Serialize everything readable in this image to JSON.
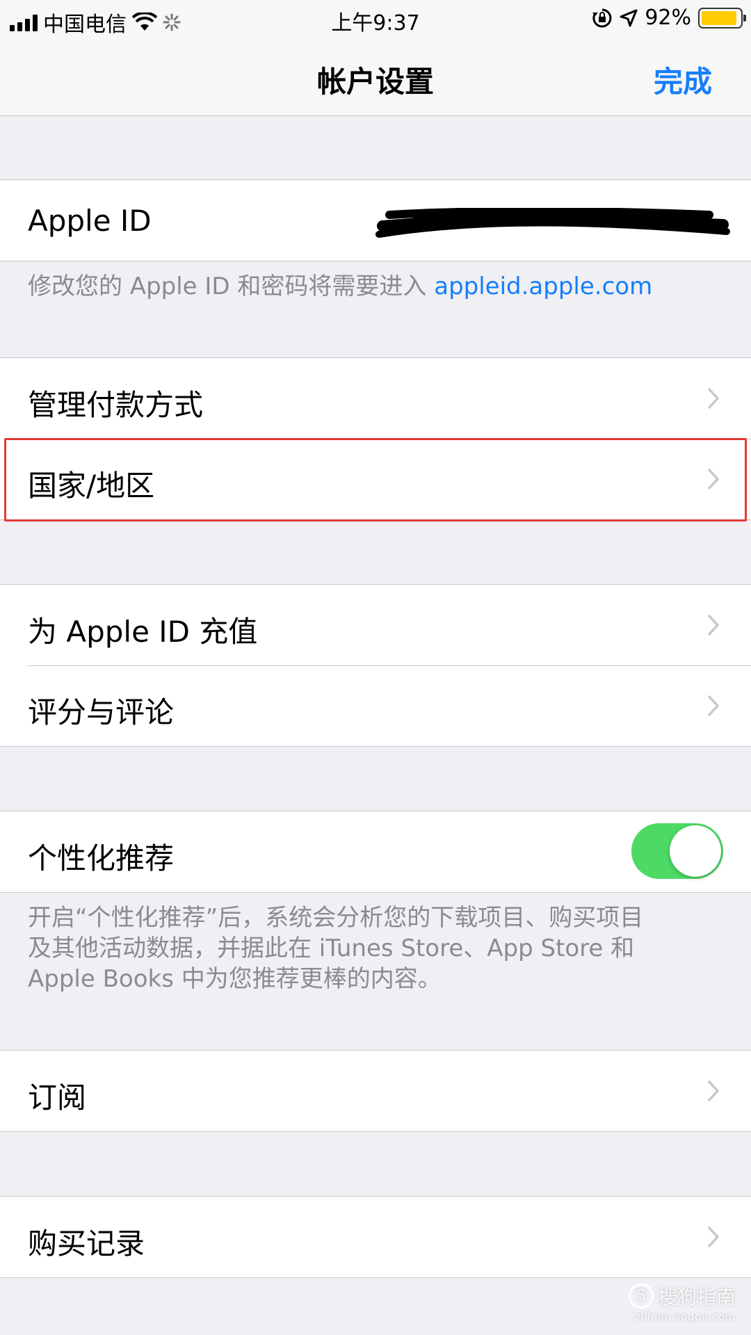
{
  "status_bar": {
    "carrier": "中国电信",
    "time": "上午9:37",
    "battery_percent": "92%",
    "battery_level": 0.92,
    "icons": [
      "signal-icon",
      "wifi-icon",
      "activity-spinner-icon",
      "orientation-lock-icon",
      "location-arrow-icon",
      "battery-icon"
    ]
  },
  "nav": {
    "title": "帐户设置",
    "done_label": "完成"
  },
  "apple_id_section": {
    "label": "Apple ID",
    "footer_text": "修改您的 Apple ID 和密码将需要进入 ",
    "footer_link": "appleid.apple.com"
  },
  "payment_section": {
    "items": [
      {
        "label": "管理付款方式"
      },
      {
        "label": "国家/地区"
      }
    ]
  },
  "store_section": {
    "items": [
      {
        "label": "为 Apple ID 充值"
      },
      {
        "label": "评分与评论"
      }
    ]
  },
  "personalization_section": {
    "label": "个性化推荐",
    "toggle_on": true,
    "footer_lines": [
      "开启“个性化推荐”后，系统会分析您的下载项目、购买项目",
      "及其他活动数据，并据此在 iTunes Store、App Store 和",
      "Apple Books 中为您推荐更棒的内容。"
    ]
  },
  "subscriptions_section": {
    "label": "订阅"
  },
  "purchase_section": {
    "label": "购买记录"
  },
  "watermark": {
    "text": "搜狗指南",
    "sub": "zhinan.sogou.com"
  },
  "colors": {
    "accent": "#157efb",
    "toggle_on": "#4cd964",
    "battery": "#ffcc00",
    "highlight": "#e53935"
  }
}
